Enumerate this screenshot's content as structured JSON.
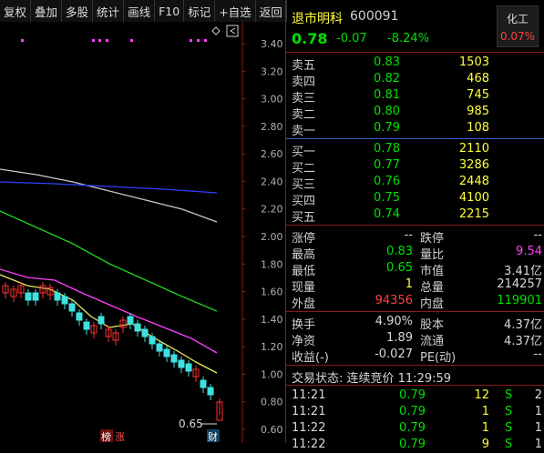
{
  "toolbar": [
    "复权",
    "叠加",
    "多股",
    "统计",
    "画线",
    "F10",
    "标记",
    "+自选",
    "返回"
  ],
  "chart": {
    "yaxis": [
      "3.40",
      "3.20",
      "3.00",
      "2.80",
      "2.60",
      "2.40",
      "2.20",
      "2.00",
      "1.80",
      "1.60",
      "1.40",
      "1.20",
      "1.00",
      "0.80",
      "0.60"
    ],
    "low_label": "0.65",
    "tags": [
      "榜",
      "涨",
      "财"
    ],
    "colors": {
      "ma_white": "#c8c8c8",
      "ma_blue": "#3040ff",
      "ma_green": "#20d020",
      "ma_magenta": "#ff40ff",
      "ma_yellow": "#e8e860",
      "up": "#ff3030",
      "down": "#40e0e0"
    }
  },
  "quote": {
    "name": "退市明科",
    "code": "600091",
    "price": "0.78",
    "change": "-0.07",
    "change_pct": "-8.24%",
    "sector_name": "化工",
    "sector_pct": "0.07%"
  },
  "asks": [
    {
      "label": "卖五",
      "price": "0.83",
      "vol": "1503"
    },
    {
      "label": "卖四",
      "price": "0.82",
      "vol": "468"
    },
    {
      "label": "卖三",
      "price": "0.81",
      "vol": "745"
    },
    {
      "label": "卖二",
      "price": "0.80",
      "vol": "985"
    },
    {
      "label": "卖一",
      "price": "0.79",
      "vol": "108"
    }
  ],
  "bids": [
    {
      "label": "买一",
      "price": "0.78",
      "vol": "2110"
    },
    {
      "label": "买二",
      "price": "0.77",
      "vol": "3286"
    },
    {
      "label": "买三",
      "price": "0.76",
      "vol": "2448"
    },
    {
      "label": "买四",
      "price": "0.75",
      "vol": "4100"
    },
    {
      "label": "买五",
      "price": "0.74",
      "vol": "2215"
    }
  ],
  "stats": {
    "limit_up_label": "涨停",
    "limit_up": "--",
    "limit_down_label": "跌停",
    "limit_down": "--",
    "high_label": "最高",
    "high": "0.83",
    "vol_ratio_label": "量比",
    "vol_ratio": "9.54",
    "low_label": "最低",
    "low": "0.65",
    "mkt_cap_label": "市值",
    "mkt_cap": "3.41亿",
    "cur_vol_label": "现量",
    "cur_vol": "1",
    "total_vol_label": "总量",
    "total_vol": "214257",
    "outer_label": "外盘",
    "outer": "94356",
    "inner_label": "内盘",
    "inner": "119901",
    "turnover_label": "换手",
    "turnover": "4.90%",
    "shares_label": "股本",
    "shares": "4.37亿",
    "nav_label": "净资",
    "nav": "1.89",
    "float_label": "流通",
    "float": "4.37亿",
    "eps_label": "收益(-)",
    "eps": "-0.027",
    "pe_label": "PE(动)",
    "pe": "--"
  },
  "status": "交易状态: 连续竞价 11:29:59",
  "ticks": [
    {
      "time": "11:21",
      "price": "0.79",
      "vol": "12",
      "side": "S",
      "num": "2"
    },
    {
      "time": "11:21",
      "price": "0.79",
      "vol": "1",
      "side": "S",
      "num": "1"
    },
    {
      "time": "11:22",
      "price": "0.79",
      "vol": "1",
      "side": "S",
      "num": "1"
    },
    {
      "time": "11:22",
      "price": "0.79",
      "vol": "9",
      "side": "S",
      "num": "1"
    }
  ]
}
